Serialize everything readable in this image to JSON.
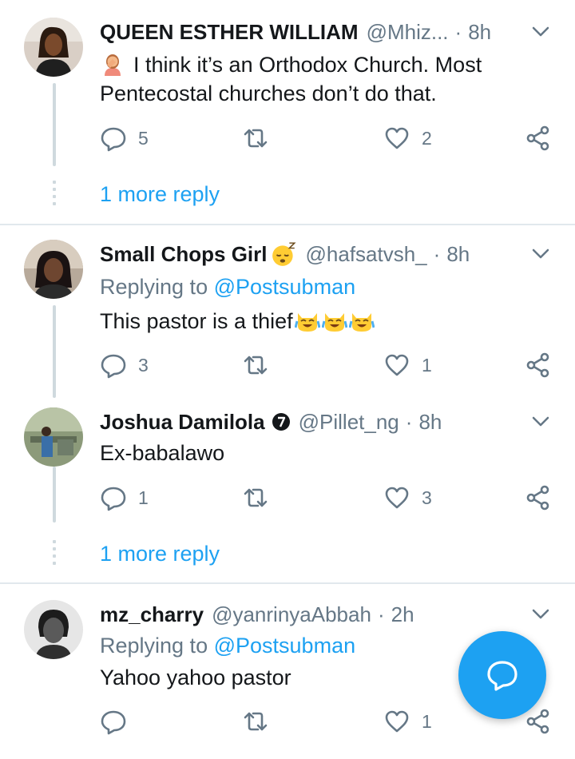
{
  "tweets": [
    {
      "name": "QUEEN ESTHER WILLIAM",
      "handle": "@Mhiz...",
      "time": "8h",
      "text": "I think it’s an Orthodox Church. Most Pentecostal churches don’t do that.",
      "replies": "5",
      "retweets": "",
      "likes": "2",
      "more_reply": "1 more reply"
    },
    {
      "name": "Small Chops Girl",
      "handle": "@hafsatvsh_",
      "time": "8h",
      "replying_prefix": "Replying to",
      "replying_to": "@Postsubman",
      "text": "This pastor is a thief",
      "replies": "3",
      "retweets": "",
      "likes": "1"
    },
    {
      "name": "Joshua Damilola",
      "handle": "@Pillet_ng",
      "time": "8h",
      "text": "Ex-babalawo",
      "replies": "1",
      "retweets": "",
      "likes": "3",
      "more_reply": "1 more reply"
    },
    {
      "name": "mz_charry",
      "handle": "@yanrinyaAbbah",
      "time": "2h",
      "replying_prefix": "Replying to",
      "replying_to": "@Postsubman",
      "text": "Yahoo yahoo pastor",
      "replies": "",
      "retweets": "",
      "likes": "1"
    }
  ],
  "colors": {
    "accent": "#1da1f2",
    "secondary_text": "#657786",
    "divider": "#e1e8ed"
  },
  "icons": [
    "reply-icon",
    "retweet-icon",
    "like-icon",
    "share-icon",
    "chevron-down-icon",
    "compose-reply-icon"
  ]
}
